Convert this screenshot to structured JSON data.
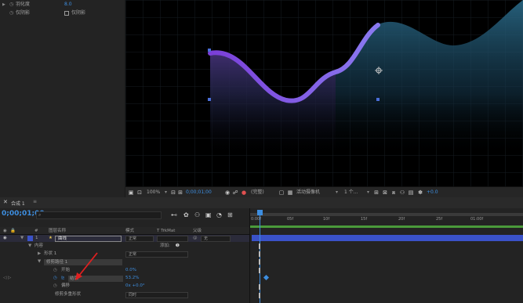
{
  "effect_controls": {
    "rows": [
      {
        "name": "羽化度",
        "value": "8.0"
      },
      {
        "name": "仅阴影",
        "checkbox_label": "仅阴影"
      }
    ]
  },
  "viewer_toolbar": {
    "zoom": "100%",
    "timecode": "0;00;01;00",
    "resolution": "(完整)",
    "camera": "活动摄像机",
    "views": "1 个...",
    "exposure": "+0.0"
  },
  "timeline": {
    "tab_label": "合成 1",
    "current_time": "0;00;01;00",
    "search_placeholder": "",
    "columns": {
      "number": "#",
      "source_name": "图层名称",
      "mode": "模式",
      "trkmat": "T  TrkMat",
      "parent": "父级"
    },
    "layers": [
      {
        "num": "1",
        "name": "曲线",
        "mode": "正常",
        "parent": "无"
      },
      {
        "name": "内容",
        "add": "添加:"
      },
      {
        "name": "形状 1",
        "mode": "正常"
      },
      {
        "name": "修剪路径 1"
      },
      {
        "name": "开始",
        "value": "0.0%"
      },
      {
        "name": "结束",
        "value": "53.2%"
      },
      {
        "name": "偏移",
        "value": "0x +0.0°"
      },
      {
        "name": "修剪多重形状",
        "value": "同时"
      }
    ],
    "ruler_ticks": [
      "0:00f",
      "05f",
      "10f",
      "15f",
      "20f",
      "25f",
      "01:00f"
    ]
  },
  "colors": {
    "accent_blue": "#3d8ee0",
    "curve_purple": "#8060e8",
    "fill_teal": "#1e7a8c",
    "track_bar": "#3a52c8"
  },
  "icons": [
    "stopwatch-icon",
    "checkbox-icon",
    "camera-icon",
    "grid-icon",
    "search-icon",
    "graph-icon"
  ]
}
